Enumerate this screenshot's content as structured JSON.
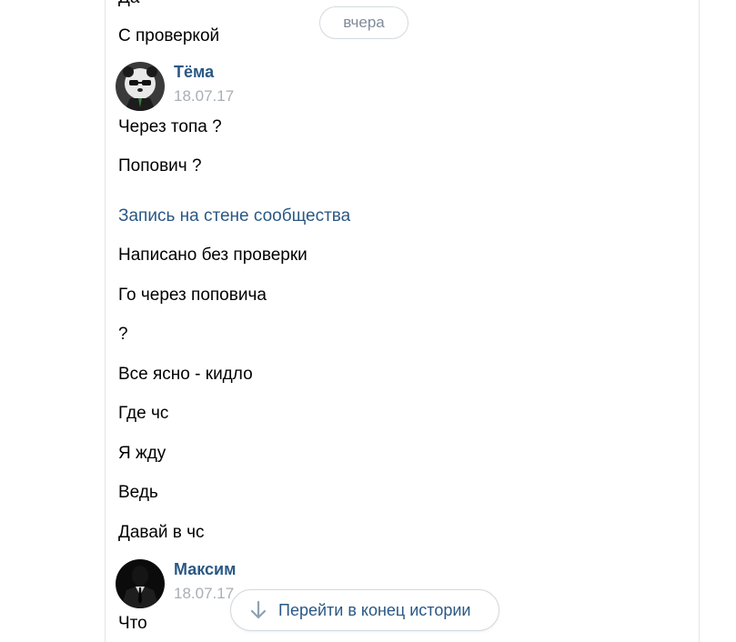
{
  "day_separator": "вчера",
  "messages_top": {
    "partial_above": "Да",
    "last": "С проверкой"
  },
  "groups": [
    {
      "author": "Тёма",
      "date": "18.07.17",
      "avatar": "panda-avatar",
      "messages": [
        "Через топа ?",
        "Попович ?",
        "Запись на стене сообщества",
        "Написано без проверки",
        "Го через поповича",
        "?",
        "Все ясно - кидло",
        "Где чс",
        "Я жду",
        "Ведь",
        "Давай в чс"
      ]
    },
    {
      "author": "Максим",
      "date": "18.07.17",
      "avatar": "suit-avatar",
      "messages": [
        "Что"
      ]
    }
  ],
  "jump_button": {
    "label": "Перейти в конец истории",
    "icon": "arrow-down-icon"
  },
  "colors": {
    "link": "#2a5885",
    "date": "#a8aeb4",
    "pill_text": "#818c99",
    "border": "#d3d9de"
  }
}
